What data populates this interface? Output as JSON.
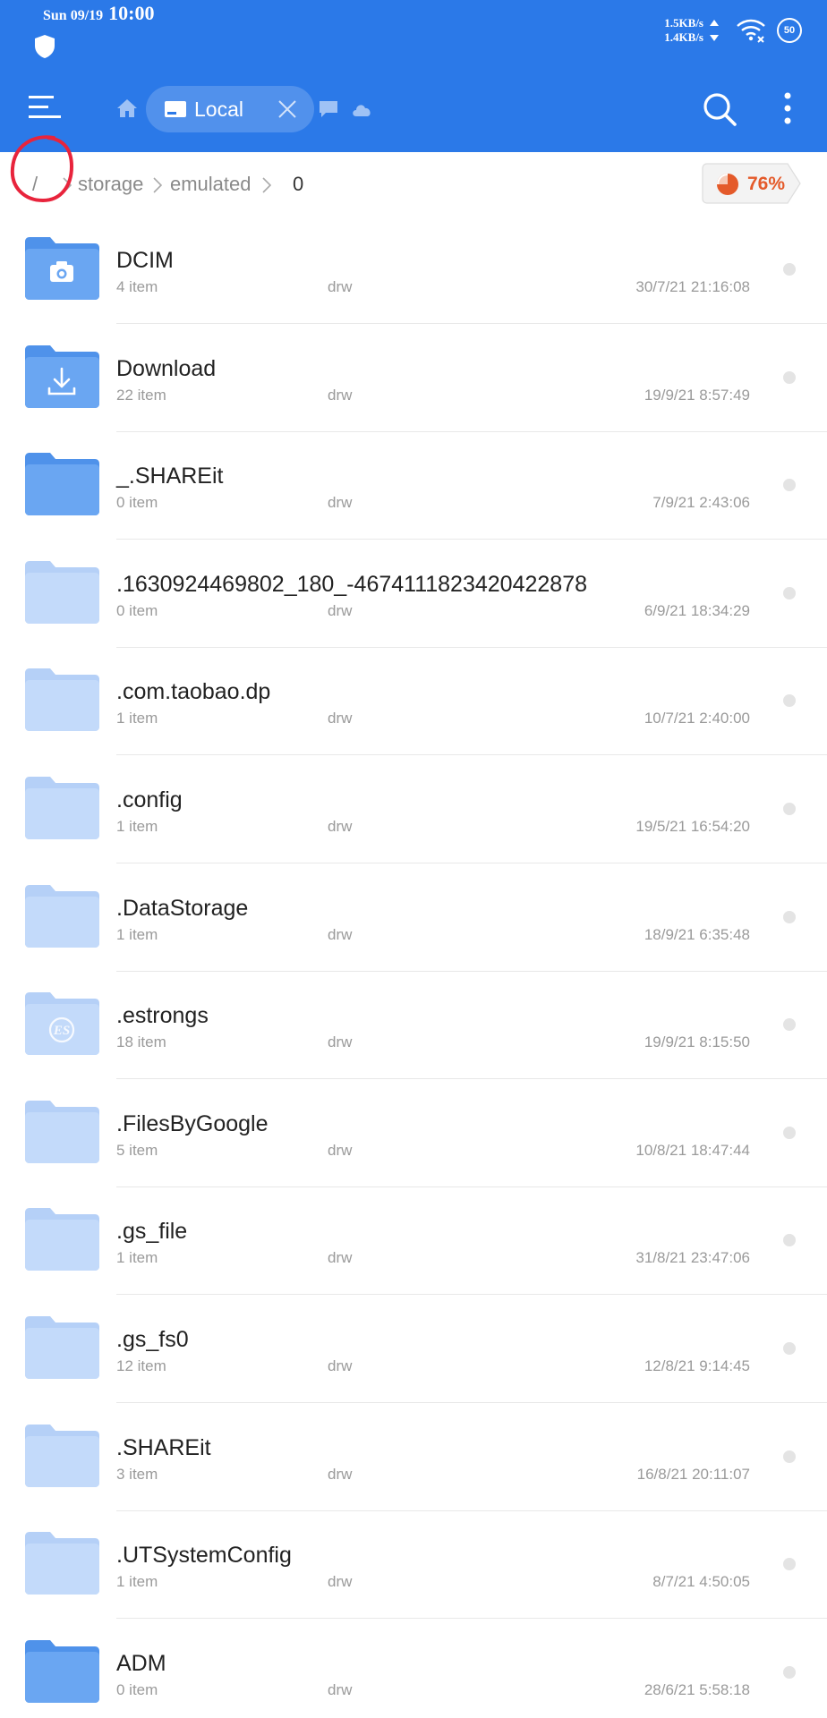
{
  "status_bar": {
    "date": "Sun 09/19",
    "time": "10:00",
    "speed_up": "1.5KB/s",
    "speed_down": "1.4KB/s",
    "battery": "50"
  },
  "toolbar": {
    "tab_label": "Local",
    "icons": [
      "menu-icon",
      "home-icon",
      "drive-icon",
      "close-icon",
      "chat-icon",
      "cloud-icon",
      "search-icon",
      "more-icon"
    ]
  },
  "breadcrumb": {
    "root": "/",
    "items": [
      "storage",
      "emulated"
    ],
    "current": "0",
    "storage_used": "76%",
    "storage_color": "#e45a2a"
  },
  "files": [
    {
      "name": "DCIM",
      "count": "4 item",
      "perm": "drw",
      "date": "30/7/21 21:16:08",
      "icon": "camera-folder-icon"
    },
    {
      "name": "Download",
      "count": "22 item",
      "perm": "drw",
      "date": "19/9/21 8:57:49",
      "icon": "download-folder-icon"
    },
    {
      "name": "_.SHAREit",
      "count": "0 item",
      "perm": "drw",
      "date": "7/9/21 2:43:06",
      "icon": "folder-icon"
    },
    {
      "name": ".1630924469802_180_-4674111823420422878",
      "count": "0 item",
      "perm": "drw",
      "date": "6/9/21 18:34:29",
      "icon": "hidden-folder-icon"
    },
    {
      "name": ".com.taobao.dp",
      "count": "1 item",
      "perm": "drw",
      "date": "10/7/21 2:40:00",
      "icon": "hidden-folder-icon"
    },
    {
      "name": ".config",
      "count": "1 item",
      "perm": "drw",
      "date": "19/5/21 16:54:20",
      "icon": "hidden-folder-icon"
    },
    {
      "name": ".DataStorage",
      "count": "1 item",
      "perm": "drw",
      "date": "18/9/21 6:35:48",
      "icon": "hidden-folder-icon"
    },
    {
      "name": ".estrongs",
      "count": "18 item",
      "perm": "drw",
      "date": "19/9/21 8:15:50",
      "icon": "es-folder-icon"
    },
    {
      "name": ".FilesByGoogle",
      "count": "5 item",
      "perm": "drw",
      "date": "10/8/21 18:47:44",
      "icon": "hidden-folder-icon"
    },
    {
      "name": ".gs_file",
      "count": "1 item",
      "perm": "drw",
      "date": "31/8/21 23:47:06",
      "icon": "hidden-folder-icon"
    },
    {
      "name": ".gs_fs0",
      "count": "12 item",
      "perm": "drw",
      "date": "12/8/21 9:14:45",
      "icon": "hidden-folder-icon"
    },
    {
      "name": ".SHAREit",
      "count": "3 item",
      "perm": "drw",
      "date": "16/8/21 20:11:07",
      "icon": "hidden-folder-icon"
    },
    {
      "name": ".UTSystemConfig",
      "count": "1 item",
      "perm": "drw",
      "date": "8/7/21 4:50:05",
      "icon": "hidden-folder-icon"
    },
    {
      "name": "ADM",
      "count": "0 item",
      "perm": "drw",
      "date": "28/6/21 5:58:18",
      "icon": "folder-icon"
    }
  ],
  "colors": {
    "header": "#2b79e8",
    "folder": "#6aa6f2",
    "hidden_folder": "#c3dafa",
    "annotation": "#e8243c"
  }
}
